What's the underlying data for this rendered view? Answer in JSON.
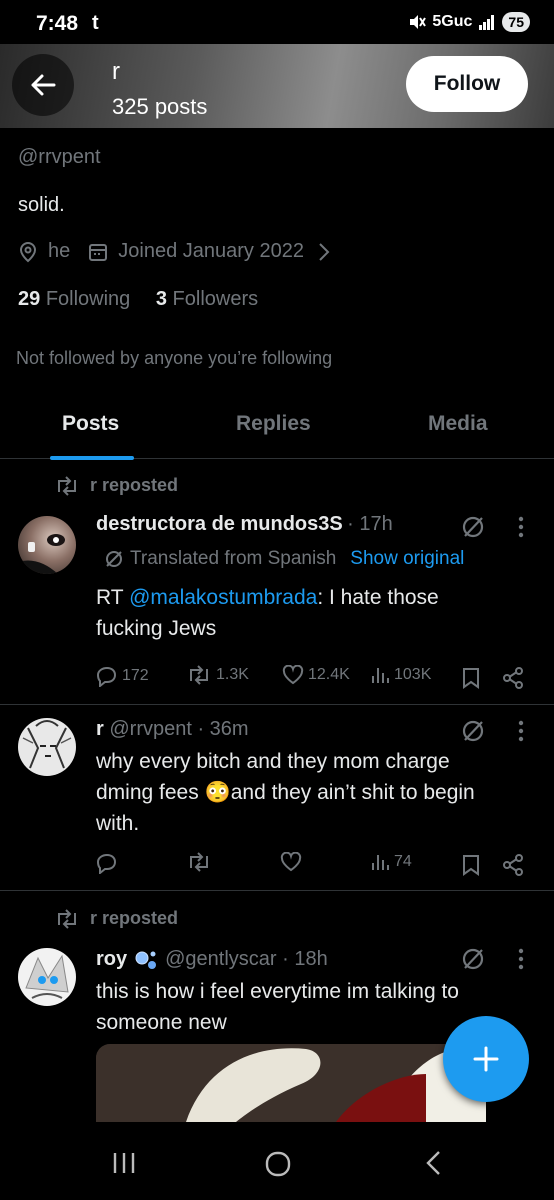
{
  "status_bar": {
    "time": "7:48",
    "carrier_icon": "t",
    "network": "5Guc",
    "battery": "75"
  },
  "header": {
    "name": "r",
    "post_count": "325 posts",
    "follow_label": "Follow"
  },
  "profile": {
    "handle": "@rrvpent",
    "bio": "solid.",
    "pronouns": "he",
    "joined": "Joined January 2022",
    "following_count": "29",
    "following_label": "Following",
    "followers_count": "3",
    "followers_label": "Followers",
    "not_followed": "Not followed by anyone you’re following"
  },
  "tabs": [
    {
      "label": "Posts"
    },
    {
      "label": "Replies"
    },
    {
      "label": "Media"
    }
  ],
  "tweets": [
    {
      "repost_label": "r reposted",
      "display_name": "destructora de mundos3S",
      "time": "· 17h",
      "translated_label": "Translated from Spanish",
      "show_original": "Show original",
      "text_prefix": "RT ",
      "mention": "@malakostumbrada",
      "text_line1_rest": ": I hate those",
      "text_line2": "fucking Jews",
      "replies": "172",
      "reposts": "1.3K",
      "likes": "12.4K",
      "views": "103K"
    },
    {
      "display_name": "r",
      "handle_time": "@rrvpent · 36m",
      "text_line1": "why every bitch and they mom charge",
      "text_line2_a": "dming fees ",
      "emoji": "😳",
      "text_line2_b": "and they ain’t shit to begin",
      "text_line3": "with.",
      "views": "74"
    },
    {
      "repost_label": "r reposted",
      "display_name": "roy",
      "handle_time": "@gentlyscar · 18h",
      "text_line1": "this is how i feel everytime im talking to",
      "text_line2": "someone new"
    }
  ],
  "icons": {
    "back": "arrow-left-icon",
    "location": "location-pin-icon",
    "calendar": "calendar-icon",
    "reply": "reply-icon",
    "repost": "repost-icon",
    "like": "heart-icon",
    "views": "views-icon",
    "bookmark": "bookmark-icon",
    "share": "share-icon",
    "grok": "grok-icon",
    "more": "more-icon",
    "compose": "plus-icon"
  },
  "colors": {
    "accent": "#1d9bf0",
    "muted": "#71767b",
    "background": "#000000",
    "text": "#e7e9ea"
  }
}
